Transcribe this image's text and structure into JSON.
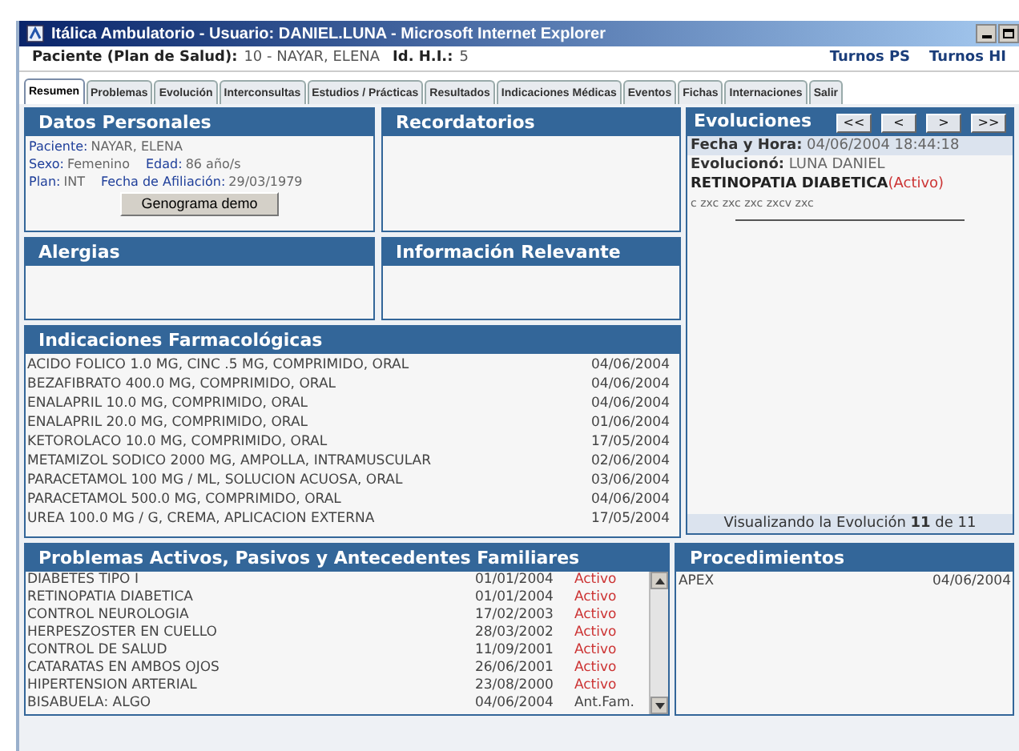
{
  "window": {
    "title": "Itálica Ambulatorio - Usuario: DANIEL.LUNA - Microsoft Internet Explorer"
  },
  "patient_bar": {
    "fields": [
      {
        "label": "Paciente (Plan de Salud):",
        "value": "10 - NAYAR, ELENA"
      },
      {
        "label": "Id. H.I.:",
        "value": "5"
      }
    ],
    "links": [
      "Turnos PS",
      "Turnos HI"
    ]
  },
  "tabs": [
    {
      "label": "Resumen",
      "selected": true
    },
    {
      "label": "Problemas",
      "selected": false
    },
    {
      "label": "Evolución",
      "selected": false
    },
    {
      "label": "Interconsultas",
      "selected": false
    },
    {
      "label": "Estudios / Prácticas",
      "selected": false
    },
    {
      "label": "Resultados",
      "selected": false
    },
    {
      "label": "Indicaciones Médicas",
      "selected": false
    },
    {
      "label": "Eventos",
      "selected": false
    },
    {
      "label": "Fichas",
      "selected": false
    },
    {
      "label": "Internaciones",
      "selected": false
    },
    {
      "label": "Salir",
      "selected": false
    }
  ],
  "datos_personales": {
    "title": "Datos Personales",
    "lines": [
      [
        {
          "label": "Paciente:",
          "value": "NAYAR, ELENA"
        }
      ],
      [
        {
          "label": "Sexo:",
          "value": "Femenino"
        },
        {
          "label": "Edad:",
          "value": "86 año/s"
        }
      ],
      [
        {
          "label": "Plan:",
          "value": "INT"
        },
        {
          "label": "Fecha de Afiliación:",
          "value": "29/03/1979"
        }
      ]
    ],
    "button": "Genograma demo"
  },
  "recordatorios": {
    "title": "Recordatorios"
  },
  "alergias": {
    "title": "Alergias"
  },
  "informacion_relevante": {
    "title": "Información Relevante"
  },
  "evoluciones": {
    "title": "Evoluciones",
    "nav_buttons": [
      "<<",
      "<",
      ">",
      ">>"
    ],
    "fecha_label": "Fecha y Hora:",
    "fecha": "04/06/2004 18:44:18",
    "autor_label": "Evolucionó:",
    "autor": "LUNA DANIEL",
    "problema": "RETINOPATIA DIABETICA",
    "estado": "(Activo)",
    "nota": "c zxc zxc zxc zxcv zxc",
    "footer": "Visualizando la Evolución **11** de 11"
  },
  "indicaciones": {
    "title": "Indicaciones Farmacológicas",
    "rows": [
      {
        "name": "ACIDO FOLICO 1.0 MG, CINC .5 MG, COMPRIMIDO, ORAL",
        "date": "04/06/2004"
      },
      {
        "name": "BEZAFIBRATO 400.0 MG, COMPRIMIDO, ORAL",
        "date": "04/06/2004"
      },
      {
        "name": "ENALAPRIL 10.0 MG, COMPRIMIDO, ORAL",
        "date": "04/06/2004"
      },
      {
        "name": "ENALAPRIL 20.0 MG, COMPRIMIDO, ORAL",
        "date": "01/06/2004"
      },
      {
        "name": "KETOROLACO 10.0 MG, COMPRIMIDO, ORAL",
        "date": "17/05/2004"
      },
      {
        "name": "METAMIZOL SODICO 2000 MG, AMPOLLA, INTRAMUSCULAR",
        "date": "02/06/2004"
      },
      {
        "name": "PARACETAMOL 100 MG / ML, SOLUCION ACUOSA, ORAL",
        "date": "03/06/2004"
      },
      {
        "name": "PARACETAMOL 500.0 MG, COMPRIMIDO, ORAL",
        "date": "04/06/2004"
      },
      {
        "name": "UREA 100.0 MG / G, CREMA, APLICACION EXTERNA",
        "date": "17/05/2004"
      }
    ]
  },
  "problemas": {
    "title": "Problemas Activos, Pasivos y Antecedentes Familiares",
    "rows": [
      {
        "name": "DIABETES TIPO I",
        "date": "01/01/2004",
        "status": "Activo",
        "color": "#cc3333"
      },
      {
        "name": "RETINOPATIA DIABETICA",
        "date": "01/01/2004",
        "status": "Activo",
        "color": "#cc3333"
      },
      {
        "name": "CONTROL NEUROLOGIA",
        "date": "17/02/2003",
        "status": "Activo",
        "color": "#cc3333"
      },
      {
        "name": "HERPESZOSTER EN CUELLO",
        "date": "28/03/2002",
        "status": "Activo",
        "color": "#cc3333"
      },
      {
        "name": "CONTROL DE SALUD",
        "date": "11/09/2001",
        "status": "Activo",
        "color": "#cc3333"
      },
      {
        "name": "CATARATAS EN AMBOS OJOS",
        "date": "26/06/2001",
        "status": "Activo",
        "color": "#cc3333"
      },
      {
        "name": "HIPERTENSION ARTERIAL",
        "date": "23/08/2000",
        "status": "Activo",
        "color": "#cc3333"
      },
      {
        "name": "BISABUELA: ALGO",
        "date": "04/06/2004",
        "status": "Ant.Fam.",
        "color": "#444444"
      }
    ]
  },
  "procedimientos": {
    "title": "Procedimientos",
    "rows": [
      {
        "name": "APEX",
        "date": "04/06/2004"
      }
    ]
  }
}
